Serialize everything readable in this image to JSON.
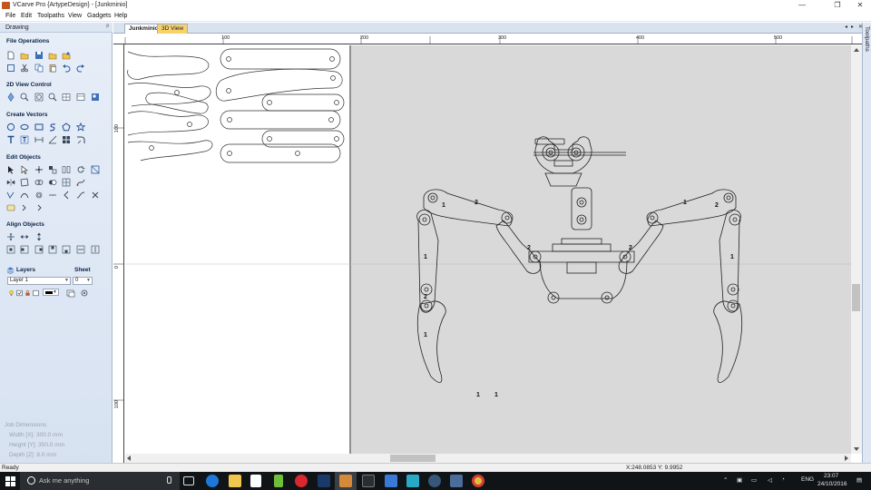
{
  "window": {
    "title": "VCarve Pro {ArtypeDesign} - [Junkminio]",
    "buttons": {
      "minimize": "—",
      "maximize": "❐",
      "close": "✕"
    }
  },
  "menu": [
    "File",
    "Edit",
    "Toolpaths",
    "View",
    "Gadgets",
    "Help"
  ],
  "left_panel": {
    "header": "Drawing",
    "pin": "📌",
    "sections": {
      "file_operations": "File Operations",
      "view_control": "2D View Control",
      "create_vectors": "Create Vectors",
      "edit_objects": "Edit Objects",
      "align_objects": "Align Objects"
    },
    "layers": {
      "label": "Layers",
      "sheet_label": "Sheet",
      "layer_value": "Layer 1",
      "sheet_value": "0"
    },
    "job_dimensions": {
      "title": "Job Dimensions",
      "width": "Width  [X]: 300.0 mm",
      "height": "Height [Y]: 350.0 mm",
      "depth": "Depth  [Z]: 8.0 mm"
    }
  },
  "tabs": {
    "doc": "Junkminio",
    "view3d": "3D View",
    "nav_left": "◂",
    "nav_right": "▸",
    "nav_close": "✕"
  },
  "toolpaths_tab": "Toolpaths",
  "rulers": {
    "top": [
      "100",
      "200",
      "300",
      "400",
      "500"
    ],
    "left": [
      "100",
      "0",
      "100"
    ]
  },
  "drawing": {
    "part_labels": [
      "1",
      "2",
      "1",
      "2",
      "1",
      "2",
      "1",
      "1",
      "2",
      "1",
      "2",
      "1"
    ]
  },
  "status": {
    "left": "Ready",
    "coords": "X:248.0853 Y:  9.9952"
  },
  "taskbar": {
    "search_placeholder": "Ask me anything",
    "lang": "ENG",
    "time": "23:07",
    "date": "24/10/2016"
  },
  "colors": {
    "panel_bg": "#dce6f3",
    "canvas_gray": "#d8d8d8",
    "taskbar": "#111417",
    "tab_active": "#f7d26a",
    "accent_orange": "#c2571f"
  }
}
